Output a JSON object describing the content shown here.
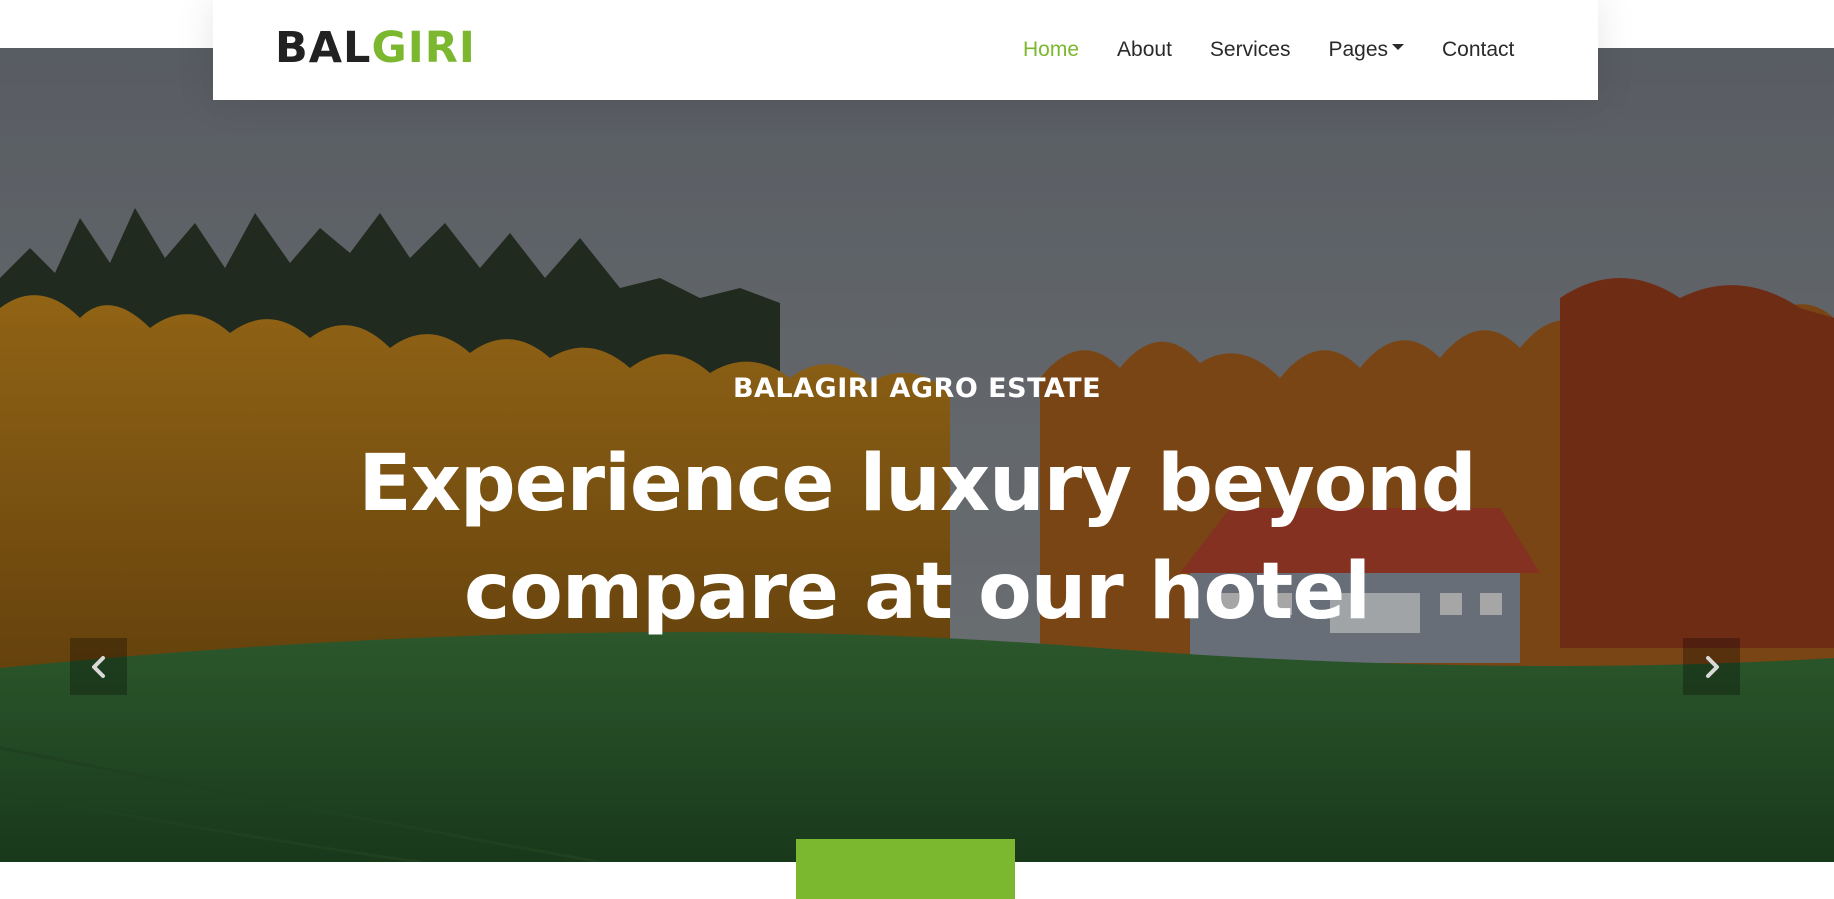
{
  "brand": {
    "part1": "BAL",
    "part2": "GIRI"
  },
  "nav": {
    "items": [
      {
        "label": "Home",
        "active": true
      },
      {
        "label": "About",
        "active": false
      },
      {
        "label": "Services",
        "active": false
      },
      {
        "label": "Pages",
        "active": false,
        "dropdown": true
      },
      {
        "label": "Contact",
        "active": false
      }
    ]
  },
  "hero": {
    "eyebrow": "BALAGIRI AGRO ESTATE",
    "title": "Experience luxury beyond compare at our hotel",
    "cta_label": ""
  },
  "carousel": {
    "prev_icon": "chevron-left-icon",
    "next_icon": "chevron-right-icon"
  },
  "colors": {
    "accent": "#7cb82f",
    "text_dark": "#222222"
  }
}
